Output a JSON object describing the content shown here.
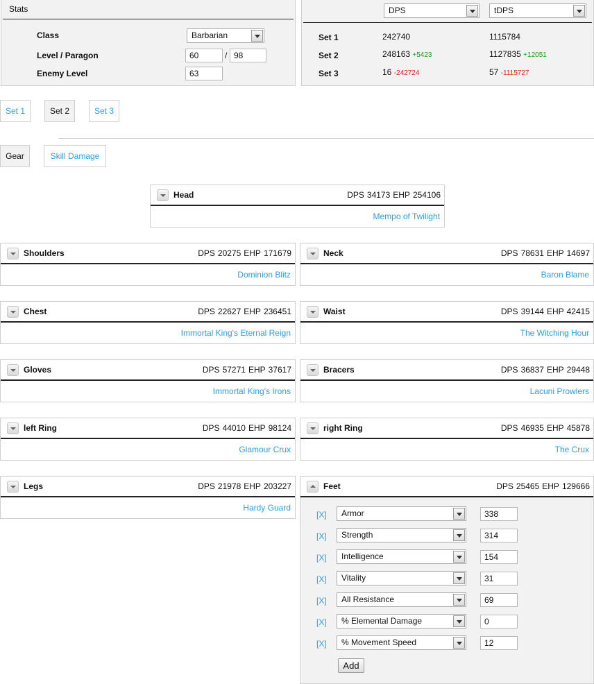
{
  "stats_panel": {
    "title": "Stats",
    "class_label": "Class",
    "class_value": "Barbarian",
    "level_label": "Level / Paragon",
    "level_value": "60",
    "separator": "/",
    "paragon_value": "98",
    "enemy_label": "Enemy Level",
    "enemy_value": "63"
  },
  "compare_panel": {
    "metric1": "DPS",
    "metric2": "tDPS",
    "rows": [
      {
        "label": "Set 1",
        "v1": "242740",
        "d1": "",
        "v2": "1115784",
        "d2": ""
      },
      {
        "label": "Set 2",
        "v1": "248163",
        "d1": "+5423",
        "v2": "1127835",
        "d2": "+12051"
      },
      {
        "label": "Set 3",
        "v1": "16",
        "d1": "-242724",
        "v2": "57",
        "d2": "-1115727"
      }
    ]
  },
  "set_tabs": [
    "Set 1",
    "Set 2",
    "Set 3"
  ],
  "view_tabs": [
    "Gear",
    "Skill Damage"
  ],
  "dps_label": "DPS",
  "ehp_label": "EHP",
  "slots": {
    "head": {
      "name": "Head",
      "dps": "34173",
      "ehp": "254106",
      "item": "Mempo of Twilight"
    },
    "shoulders": {
      "name": "Shoulders",
      "dps": "20275",
      "ehp": "171679",
      "item": "Dominion Blitz"
    },
    "neck": {
      "name": "Neck",
      "dps": "78631",
      "ehp": "14697",
      "item": "Baron Blame"
    },
    "chest": {
      "name": "Chest",
      "dps": "22627",
      "ehp": "236451",
      "item": "Immortal King's Eternal Reign"
    },
    "waist": {
      "name": "Waist",
      "dps": "39144",
      "ehp": "42415",
      "item": "The Witching Hour"
    },
    "gloves": {
      "name": "Gloves",
      "dps": "57271",
      "ehp": "37617",
      "item": "Immortal King's Irons"
    },
    "bracers": {
      "name": "Bracers",
      "dps": "36837",
      "ehp": "29448",
      "item": "Lacuni Prowlers"
    },
    "left_ring": {
      "name": "left Ring",
      "dps": "44010",
      "ehp": "98124",
      "item": "Glamour Crux"
    },
    "right_ring": {
      "name": "right Ring",
      "dps": "46935",
      "ehp": "45878",
      "item": "The Crux"
    },
    "legs": {
      "name": "Legs",
      "dps": "21978",
      "ehp": "203227",
      "item": "Hardy Guard"
    },
    "feet": {
      "name": "Feet",
      "dps": "25465",
      "ehp": "129666",
      "item": ""
    }
  },
  "feet_affixes": [
    {
      "remove": "[X]",
      "stat": "Armor",
      "value": "338"
    },
    {
      "remove": "[X]",
      "stat": "Strength",
      "value": "314"
    },
    {
      "remove": "[X]",
      "stat": "Intelligence",
      "value": "154"
    },
    {
      "remove": "[X]",
      "stat": "Vitality",
      "value": "31"
    },
    {
      "remove": "[X]",
      "stat": "All Resistance",
      "value": "69"
    },
    {
      "remove": "[X]",
      "stat": "% Elemental Damage",
      "value": "0"
    },
    {
      "remove": "[X]",
      "stat": "% Movement Speed",
      "value": "12"
    }
  ],
  "add_button": "Add",
  "colors": {
    "link": "#2f9ee0",
    "positive": "#1a9a1a",
    "negative": "#e02020",
    "panel_bg": "#f2f2f2"
  }
}
